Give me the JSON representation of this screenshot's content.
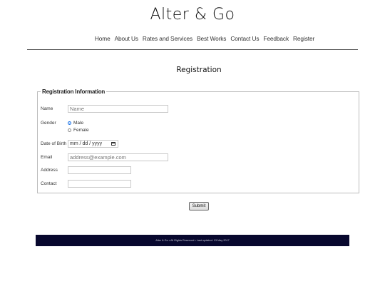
{
  "site": {
    "title": "Alter & Go"
  },
  "nav": {
    "items": [
      {
        "label": "Home"
      },
      {
        "label": "About Us"
      },
      {
        "label": "Rates and Services"
      },
      {
        "label": "Best Works"
      },
      {
        "label": "Contact Us"
      },
      {
        "label": "Feedback"
      },
      {
        "label": "Register"
      }
    ]
  },
  "page": {
    "heading": "Registration"
  },
  "form": {
    "legend": "Registration Information",
    "name": {
      "label": "Name",
      "placeholder": "Name",
      "value": ""
    },
    "gender": {
      "label": "Gender",
      "options": [
        {
          "label": "Male",
          "checked": true
        },
        {
          "label": "Female",
          "checked": false
        }
      ]
    },
    "dob": {
      "label": "Date of Birth",
      "placeholder": "mm / dd / yyyy"
    },
    "email": {
      "label": "Email",
      "placeholder": "address@example.com",
      "value": ""
    },
    "address": {
      "label": "Address",
      "value": ""
    },
    "contact": {
      "label": "Contact",
      "value": ""
    },
    "submit_label": "Submit"
  },
  "footer": {
    "text": "Alter & Go  •  All Rights Reserved  •  Last updated: 13 May 2017"
  },
  "colors": {
    "footer_bg": "#08082e",
    "radio_accent": "#1a73e8"
  },
  "icons": {
    "date_picker": "calendar-icon"
  }
}
